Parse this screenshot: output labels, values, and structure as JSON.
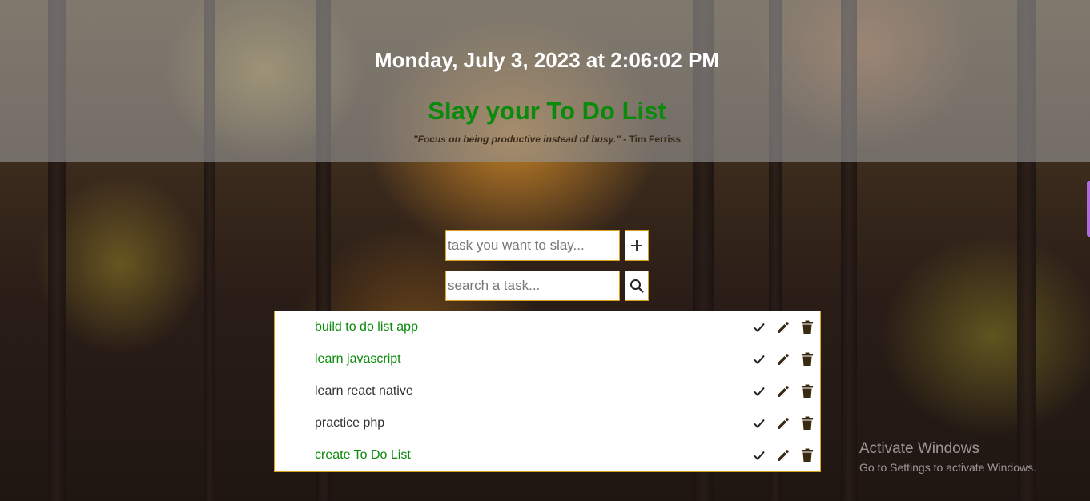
{
  "header": {
    "datetime": "Monday, July 3, 2023 at 2:06:02 PM",
    "title": "Slay your To Do List",
    "quote_text": "\"Focus on being productive instead of busy.\"",
    "quote_author": " - Tim Ferriss"
  },
  "add_task": {
    "placeholder": "task you want to slay...",
    "value": "",
    "button_icon": "plus-icon"
  },
  "search": {
    "placeholder": "search a task...",
    "value": "",
    "button_icon": "search-icon"
  },
  "tasks": [
    {
      "text": "build to do list app",
      "completed": true
    },
    {
      "text": "learn javascript",
      "completed": true
    },
    {
      "text": "learn react native",
      "completed": false
    },
    {
      "text": "practice php",
      "completed": false
    },
    {
      "text": "create To Do List",
      "completed": true
    }
  ],
  "task_action_icons": [
    "check-icon",
    "pencil-icon",
    "trash-icon"
  ],
  "watermark": {
    "title": "Activate Windows",
    "subtitle": "Go to Settings to activate Windows."
  },
  "colors": {
    "title_green": "#0a8a0a",
    "border_gold": "#d9a21b",
    "icon_brown": "#3a2a12"
  }
}
